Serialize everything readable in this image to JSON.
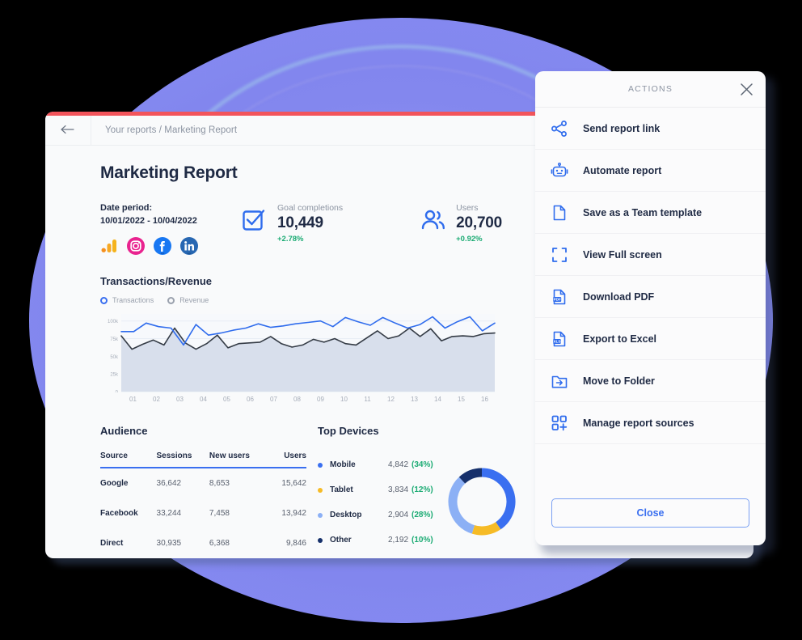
{
  "report": {
    "breadcrumb": "Your reports / Marketing Report",
    "back_icon": "back-arrow-icon",
    "title": "Marketing Report",
    "accent_color": "#f2545b",
    "period": {
      "label": "Date period:",
      "value": "10/01/2022 - 10/04/2022"
    },
    "source_icons": [
      {
        "name": "google-analytics-icon",
        "title": "Google Analytics"
      },
      {
        "name": "instagram-icon",
        "title": "Instagram"
      },
      {
        "name": "facebook-ads-icon",
        "title": "Facebook Ads"
      },
      {
        "name": "linkedin-ads-icon",
        "title": "LinkedIn Ads"
      }
    ],
    "metrics": [
      {
        "icon": "goal-check-icon",
        "label": "Goal completions",
        "value": "10,449",
        "delta": "+2.78%"
      },
      {
        "icon": "users-icon",
        "label": "Users",
        "value": "20,700",
        "delta": "+0.92%"
      }
    ],
    "audience": {
      "title": "Audience",
      "columns": [
        "Source",
        "Sessions",
        "New users",
        "Users"
      ],
      "rows": [
        [
          "Google",
          "36,642",
          "8,653",
          "15,642"
        ],
        [
          "Facebook",
          "33,244",
          "7,458",
          "13,942"
        ],
        [
          "Direct",
          "30,935",
          "6,368",
          "9,846"
        ]
      ]
    },
    "devices": {
      "title": "Top Devices",
      "items": [
        {
          "name": "Mobile",
          "value": "4,842",
          "percent": "(34%)",
          "color": "#3a6ff0",
          "pct_num": 34
        },
        {
          "name": "Tablet",
          "value": "3,834",
          "percent": "(12%)",
          "color": "#f6bb26",
          "pct_num": 12
        },
        {
          "name": "Desktop",
          "value": "2,904",
          "percent": "(28%)",
          "color": "#8cb0f5",
          "pct_num": 28
        },
        {
          "name": "Other",
          "value": "2,192",
          "percent": "(10%)",
          "color": "#16306b",
          "pct_num": 10
        }
      ]
    }
  },
  "chart_data": {
    "type": "line",
    "title": "Transactions/Revenue",
    "xlabel": "",
    "ylabel": "",
    "grid": true,
    "legend_position": "top-left",
    "ylim": [
      0,
      110000
    ],
    "yticks": [
      0,
      25000,
      50000,
      75000,
      100000
    ],
    "ytick_labels": [
      "0",
      "25k",
      "50k",
      "75k",
      "100k"
    ],
    "categories": [
      "01",
      "02",
      "03",
      "04",
      "05",
      "06",
      "07",
      "08",
      "09",
      "10",
      "11",
      "12",
      "13",
      "14",
      "15",
      "16"
    ],
    "x": [
      1,
      1.5,
      2,
      2.5,
      3,
      3.5,
      4,
      4.5,
      5,
      5.5,
      6,
      6.5,
      7,
      7.5,
      8,
      8.5,
      9,
      9.5,
      10,
      10.5,
      11,
      11.5,
      12,
      12.5,
      13,
      13.5,
      14,
      14.5,
      15,
      15.5,
      16
    ],
    "series": [
      {
        "name": "Transactions",
        "color": "#2f6ced",
        "filled": false,
        "values": [
          85000,
          85000,
          97000,
          92000,
          90000,
          66000,
          95000,
          80000,
          83000,
          87000,
          90000,
          96000,
          91000,
          93000,
          96000,
          98000,
          100000,
          92000,
          105000,
          99000,
          94000,
          105000,
          97000,
          90000,
          95000,
          106000,
          90000,
          99000,
          106000,
          86000,
          97000
        ]
      },
      {
        "name": "Revenue",
        "color": "#343b45",
        "filled": true,
        "values": [
          79000,
          60000,
          67000,
          73000,
          66000,
          90000,
          69000,
          60000,
          68000,
          80000,
          62000,
          68000,
          69000,
          70000,
          78000,
          68000,
          63000,
          66000,
          74000,
          70000,
          75000,
          68000,
          66000,
          76000,
          86000,
          75000,
          79000,
          90000,
          78000,
          89000,
          72000,
          78000,
          79000,
          78000,
          82000,
          83000
        ]
      }
    ]
  },
  "actions_panel": {
    "header": "ACTIONS",
    "close_icon": "close-icon",
    "items": [
      {
        "icon": "share-icon",
        "label": "Send report link"
      },
      {
        "icon": "robot-icon",
        "label": "Automate report"
      },
      {
        "icon": "document-icon",
        "label": "Save as a Team template"
      },
      {
        "icon": "fullscreen-icon",
        "label": "View Full screen"
      },
      {
        "icon": "pdf-file-icon",
        "label": "Download PDF"
      },
      {
        "icon": "xls-file-icon",
        "label": "Export to Excel"
      },
      {
        "icon": "move-folder-icon",
        "label": "Move to Folder"
      },
      {
        "icon": "grid-plus-icon",
        "label": "Manage report sources"
      }
    ],
    "close_button": "Close"
  }
}
